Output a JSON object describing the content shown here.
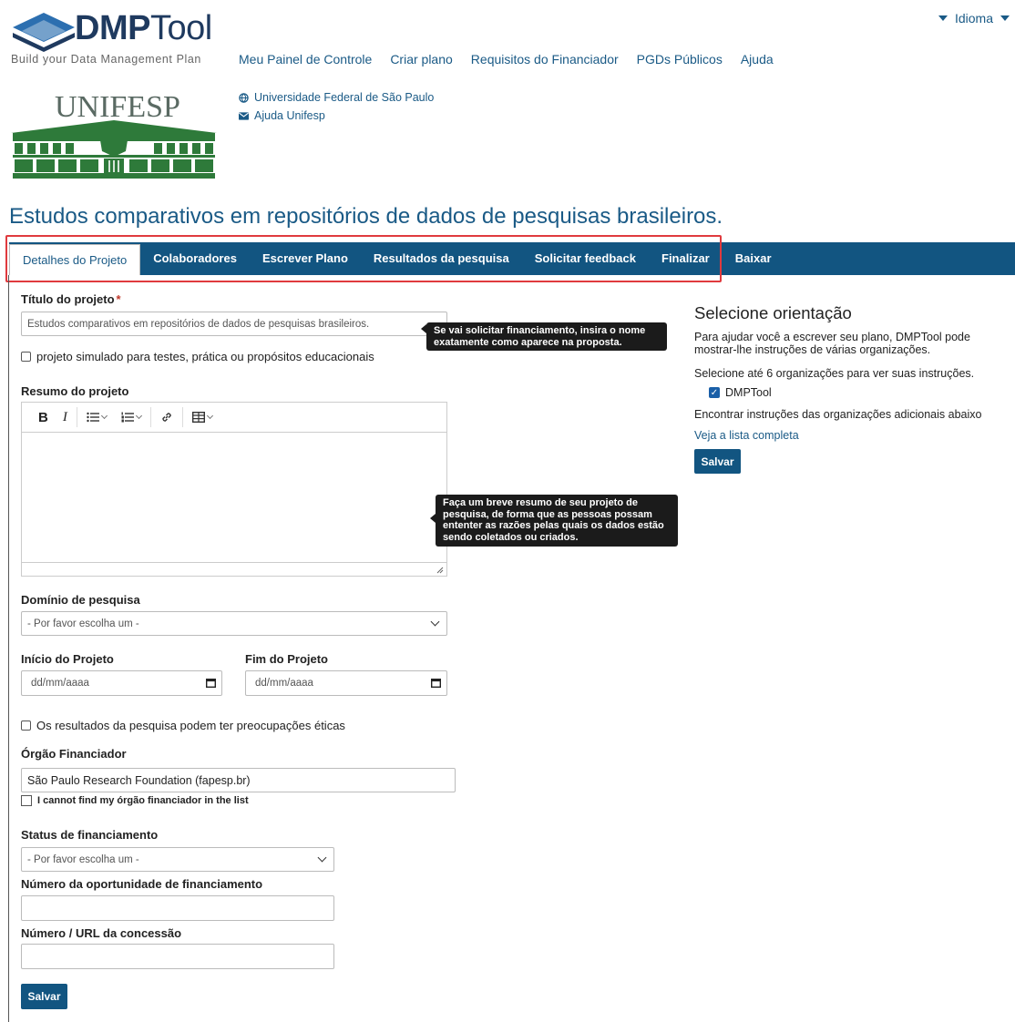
{
  "header": {
    "logo_bold": "DMP",
    "logo_light": "Tool",
    "tagline": "Build your Data Management Plan",
    "nav": [
      "Meu Painel de Controle",
      "Criar plano",
      "Requisitos do Financiador",
      "PGDs Públicos",
      "Ajuda"
    ],
    "language_label": "Idioma"
  },
  "organization": {
    "logo_text": "UNIFESP",
    "links": [
      "Universidade Federal de São Paulo",
      "Ajuda Unifesp"
    ]
  },
  "plan_title": "Estudos comparativos em repositórios de dados de pesquisas brasileiros.",
  "tabs": [
    {
      "label": "Detalhes do Projeto",
      "active": true
    },
    {
      "label": "Colaboradores"
    },
    {
      "label": "Escrever Plano"
    },
    {
      "label": "Resultados da pesquisa"
    },
    {
      "label": "Solicitar feedback"
    },
    {
      "label": "Finalizar"
    },
    {
      "label": "Baixar"
    }
  ],
  "form": {
    "project_title_label": "Título do projeto",
    "required_mark": "*",
    "project_title_value": "Estudos comparativos em repositórios de dados de pesquisas brasileiros.",
    "project_title_tip": "Se vai solicitar financiamento, insira o nome exatamente como aparece na proposta.",
    "test_plan_label": "projeto simulado para testes, prática ou propósitos educacionais",
    "abstract_label": "Resumo do projeto",
    "abstract_tip": "Faça um breve resumo de seu projeto de pesquisa, de forma que as pessoas possam ententer as razões pelas quais os dados estão sendo coletados ou criados.",
    "toolbar": {
      "bold": "B",
      "italic": "I"
    },
    "research_domain_label": "Domínio de pesquisa",
    "research_domain_value": "- Por favor escolha um -",
    "start_label": "Início do Projeto",
    "end_label": "Fim do Projeto",
    "date_placeholder": "dd/mm/aaaa",
    "ethics_label": "Os resultados da pesquisa podem ter preocupações éticas",
    "funder_label": "Órgão Financiador",
    "funder_value": "São Paulo Research Foundation (fapesp.br)",
    "funder_not_found_label": "I cannot find my órgão financiador in the list",
    "funding_status_label": "Status de financiamento",
    "funding_status_value": "- Por favor escolha um -",
    "opportunity_label": "Número da oportunidade de financiamento",
    "grant_label": "Número / URL da concessão",
    "save_label": "Salvar"
  },
  "guidance": {
    "title": "Selecione orientação",
    "intro": "Para ajudar você a escrever seu plano, DMPTool pode mostrar-lhe instruções de várias organizações.",
    "select_prompt": "Selecione até 6 organizações para ver suas instruções.",
    "org_option": "DMPTool",
    "find_more": "Encontrar instruções das organizações adicionais abaixo",
    "see_full_list": "Veja a lista completa",
    "save_label": "Salvar"
  },
  "colors": {
    "primary": "#125581",
    "link": "#1a5a86",
    "highlight": "#e03a3e",
    "unifesp_green": "#2e7a3a"
  }
}
